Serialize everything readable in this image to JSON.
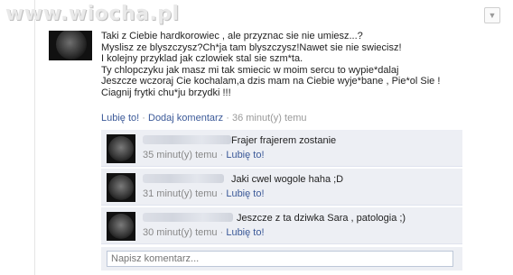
{
  "watermark": "www.wiocha.pl",
  "post": {
    "lines": [
      "Taki z Ciebie hardkorowiec , ale przyznac sie nie umiesz...?",
      "Myslisz ze blyszczysz?Ch*ja tam blyszczysz!Nawet sie nie swiecisz!",
      "I kolejny przyklad jak czlowiek stal sie szm*ta.",
      "Ty chlopczyku jak masz mi tak smiecic w moim sercu to wypie*dalaj",
      "Jeszcze wczoraj Cie kochalam,a dzis mam na Ciebie wyje*bane , Pie*ol Sie !",
      "Ciagnij frytki chu*ju brzydki !!!"
    ],
    "like_label": "Lubię to!",
    "comment_label": "Dodaj komentarz",
    "time": "36 minut(y) temu",
    "separator": "·"
  },
  "comments": [
    {
      "text": "Frajer frajerem zostanie",
      "time": "35 minut(y) temu",
      "like": "Lubię to!"
    },
    {
      "text": "Jaki cwel wogole haha ;D",
      "time": "31 minut(y) temu",
      "like": "Lubię to!"
    },
    {
      "text": "Jeszcze z ta dziwka Sara , patologia ;)",
      "time": "30 minut(y) temu",
      "like": "Lubię to!"
    }
  ],
  "composer": {
    "placeholder": "Napisz komentarz..."
  },
  "icons": {
    "menu": "chevron-down-icon"
  }
}
